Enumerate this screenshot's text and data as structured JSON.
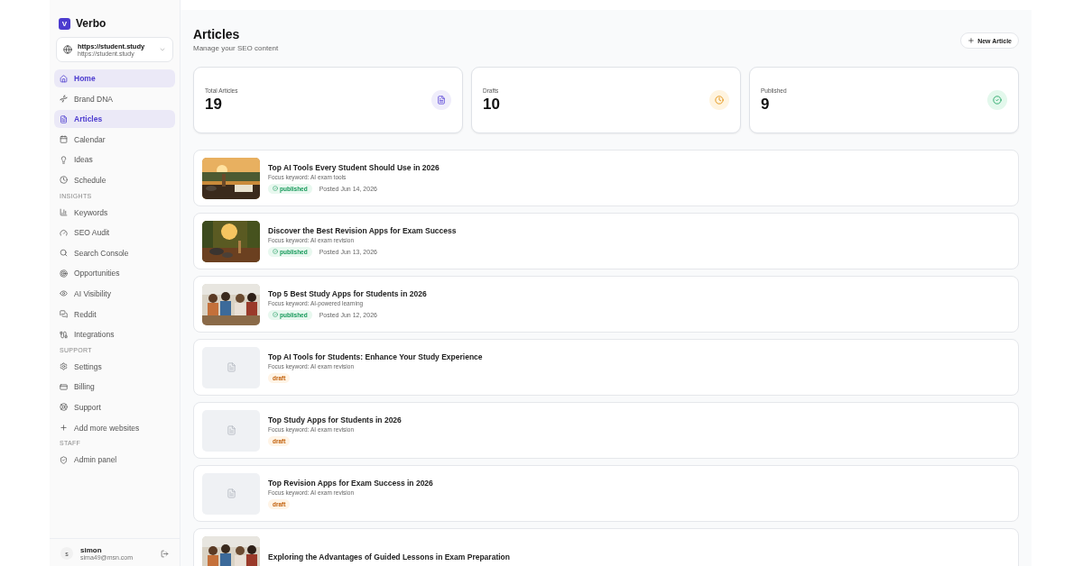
{
  "brand": {
    "logo": "V",
    "name": "Verbo"
  },
  "site": {
    "title": "https://student.study",
    "url": "https://student.study"
  },
  "nav": [
    {
      "items": [
        {
          "label": "Home",
          "selected": true
        },
        {
          "label": "Brand DNA",
          "selected": false
        },
        {
          "label": "Articles",
          "selected": true
        },
        {
          "label": "Calendar",
          "selected": false
        },
        {
          "label": "Ideas",
          "selected": false
        },
        {
          "label": "Schedule",
          "selected": false
        }
      ]
    },
    {
      "heading": "INSIGHTS",
      "items": [
        {
          "label": "Keywords",
          "selected": false
        },
        {
          "label": "SEO Audit",
          "selected": false
        },
        {
          "label": "Search Console",
          "selected": false
        },
        {
          "label": "Opportunities",
          "selected": false
        },
        {
          "label": "AI Visibility",
          "selected": false
        },
        {
          "label": "Reddit",
          "selected": false
        },
        {
          "label": "Integrations",
          "selected": false
        }
      ]
    },
    {
      "heading": "SUPPORT",
      "items": [
        {
          "label": "Settings",
          "selected": false
        },
        {
          "label": "Billing",
          "selected": false
        },
        {
          "label": "Support",
          "selected": false
        },
        {
          "label": "Add more websites",
          "selected": false
        }
      ]
    },
    {
      "heading": "STAFF",
      "items": [
        {
          "label": "Admin panel",
          "selected": false
        }
      ]
    }
  ],
  "user": {
    "initial": "s",
    "name": "simon",
    "email": "sima49@msn.com"
  },
  "header": {
    "title": "Articles",
    "subtitle": "Manage your SEO content",
    "button": "New Article"
  },
  "stats": [
    {
      "kind": "total",
      "label": "Total Articles",
      "value": "19"
    },
    {
      "kind": "drafts",
      "label": "Drafts",
      "value": "10"
    },
    {
      "kind": "published",
      "label": "Published",
      "value": "9"
    }
  ],
  "articles": [
    {
      "title": "Top AI Tools Every Student Should Use in 2026",
      "keyword": "Focus keyword: AI exam tools",
      "kind": "published",
      "badge": "published",
      "date": "Posted Jun 14, 2026"
    },
    {
      "title": "Discover the Best Revision Apps for Exam Success",
      "keyword": "Focus keyword: AI exam revision",
      "kind": "published",
      "badge": "published",
      "date": "Posted Jun 13, 2026"
    },
    {
      "title": "Top 5 Best Study Apps for Students in 2026",
      "keyword": "Focus keyword: AI-powered learning",
      "kind": "published",
      "badge": "published",
      "date": "Posted Jun 12, 2026"
    },
    {
      "title": "Top AI Tools for Students: Enhance Your Study Experience",
      "keyword": "Focus keyword: AI exam revision",
      "kind": "draft",
      "badge": "draft",
      "image": {
        "kind": "placeholder"
      }
    },
    {
      "title": "Top Study Apps for Students in 2026",
      "keyword": "Focus keyword: AI exam revision",
      "kind": "draft",
      "badge": "draft",
      "image": {
        "kind": "placeholder"
      }
    },
    {
      "title": "Top Revision Apps for Exam Success in 2026",
      "keyword": "Focus keyword: AI exam revision",
      "kind": "draft",
      "badge": "draft",
      "image": {
        "kind": "placeholder"
      }
    },
    {
      "title": "Exploring the Advantages of Guided Lessons in Exam Preparation"
    }
  ]
}
